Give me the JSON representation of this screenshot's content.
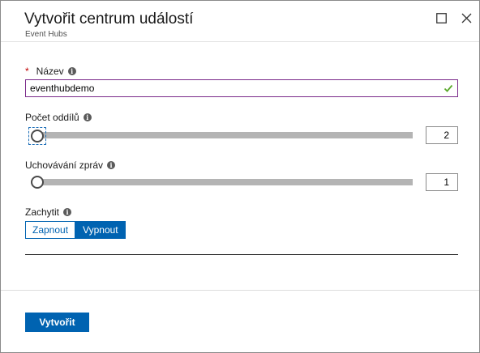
{
  "header": {
    "title": "Vytvořit centrum událostí",
    "subtitle": "Event Hubs",
    "maximize_icon": "maximize-icon",
    "close_icon": "close-icon"
  },
  "form": {
    "name": {
      "required_mark": "*",
      "label": "Název",
      "value": "eventhubdemo",
      "valid_icon": "checkmark-icon",
      "valid_color": "#5aa82a"
    },
    "partitions": {
      "label": "Počet oddílů",
      "value": "2",
      "level": 0
    },
    "retention": {
      "label": "Uchovávání zpráv",
      "value": "1",
      "level": 0
    },
    "capture": {
      "label": "Zachytit",
      "options": [
        "Zapnout",
        "Vypnout"
      ],
      "selected": "Vypnout"
    },
    "info_icon_glyph": "i"
  },
  "footer": {
    "create_label": "Vytvořit"
  },
  "colors": {
    "accent": "#0063b1",
    "required": "#c00000",
    "input_border": "#7a2a8a",
    "slider_track": "#b4b4b4"
  }
}
